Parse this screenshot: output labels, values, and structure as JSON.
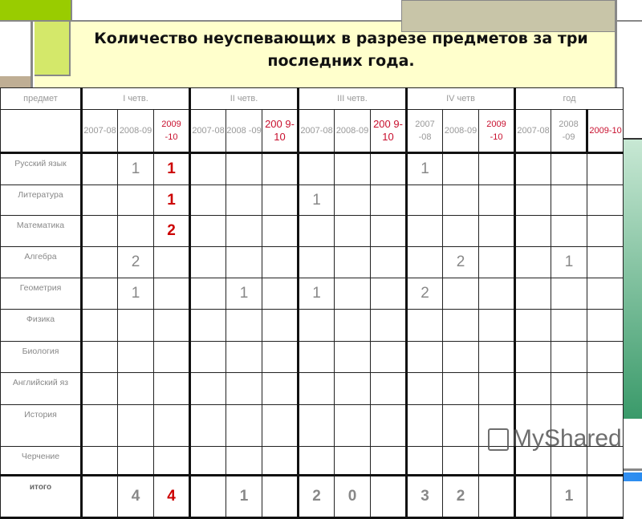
{
  "title": "Количество неуспевающих в разрезе предметов за три последних года.",
  "colors": {
    "accent_green": "#99cc00",
    "light_green": "#d4e86a",
    "title_bg": "#ffffcc",
    "tan": "#c8c5a8",
    "red": "#c8102e",
    "side_gradient": "#3a9a6a"
  },
  "table": {
    "subject_header": "предмет",
    "quarters": [
      "I четв.",
      "II четв.",
      "III четв.",
      "IV четв",
      "год"
    ],
    "years": [
      [
        "2007-08",
        "2008-09",
        "2009 -10"
      ],
      [
        "2007-08",
        "2008 -09",
        "200 9-10"
      ],
      [
        "2007-08",
        "2008-09",
        "200 9-10"
      ],
      [
        "2007 -08",
        "2008-09",
        "2009 -10"
      ],
      [
        "2007-08",
        "2008 -09",
        "2009-10"
      ]
    ],
    "rows": [
      {
        "subject": "Русский язык",
        "values": [
          "",
          "1",
          "1",
          "",
          "",
          "",
          "",
          "",
          "",
          "1",
          "",
          "",
          "",
          "",
          ""
        ]
      },
      {
        "subject": "Литература",
        "values": [
          "",
          "",
          "1",
          "",
          "",
          "",
          "1",
          "",
          "",
          "",
          "",
          "",
          "",
          "",
          ""
        ]
      },
      {
        "subject": "Математика",
        "values": [
          "",
          "",
          "2",
          "",
          "",
          "",
          "",
          "",
          "",
          "",
          "",
          "",
          "",
          "",
          ""
        ]
      },
      {
        "subject": "Алгебра",
        "values": [
          "",
          "2",
          "",
          "",
          "",
          "",
          "",
          "",
          "",
          "",
          "2",
          "",
          "",
          "1",
          ""
        ]
      },
      {
        "subject": "Геометрия",
        "values": [
          "",
          "1",
          "",
          "",
          "1",
          "",
          "1",
          "",
          "",
          "2",
          "",
          "",
          "",
          "",
          ""
        ]
      },
      {
        "subject": "Физика",
        "values": [
          "",
          "",
          "",
          "",
          "",
          "",
          "",
          "",
          "",
          "",
          "",
          "",
          "",
          "",
          ""
        ]
      },
      {
        "subject": "Биология",
        "values": [
          "",
          "",
          "",
          "",
          "",
          "",
          "",
          "",
          "",
          "",
          "",
          "",
          "",
          "",
          ""
        ]
      },
      {
        "subject": "Английский яз",
        "values": [
          "",
          "",
          "",
          "",
          "",
          "",
          "",
          "",
          "",
          "",
          "",
          "",
          "",
          "",
          ""
        ]
      },
      {
        "subject": "История",
        "values": [
          "",
          "",
          "",
          "",
          "",
          "",
          "",
          "",
          "",
          "",
          "",
          "",
          "",
          "",
          ""
        ]
      },
      {
        "subject": "Черчение",
        "values": [
          "",
          "",
          "",
          "",
          "",
          "",
          "",
          "",
          "",
          "",
          "",
          "",
          "",
          "",
          ""
        ]
      }
    ],
    "total": {
      "label": "итого",
      "values": [
        "",
        "4",
        "4",
        "",
        "1",
        "",
        "2",
        "0",
        "",
        "3",
        "2",
        "",
        "",
        "1",
        ""
      ]
    }
  },
  "watermark": "MyShared"
}
